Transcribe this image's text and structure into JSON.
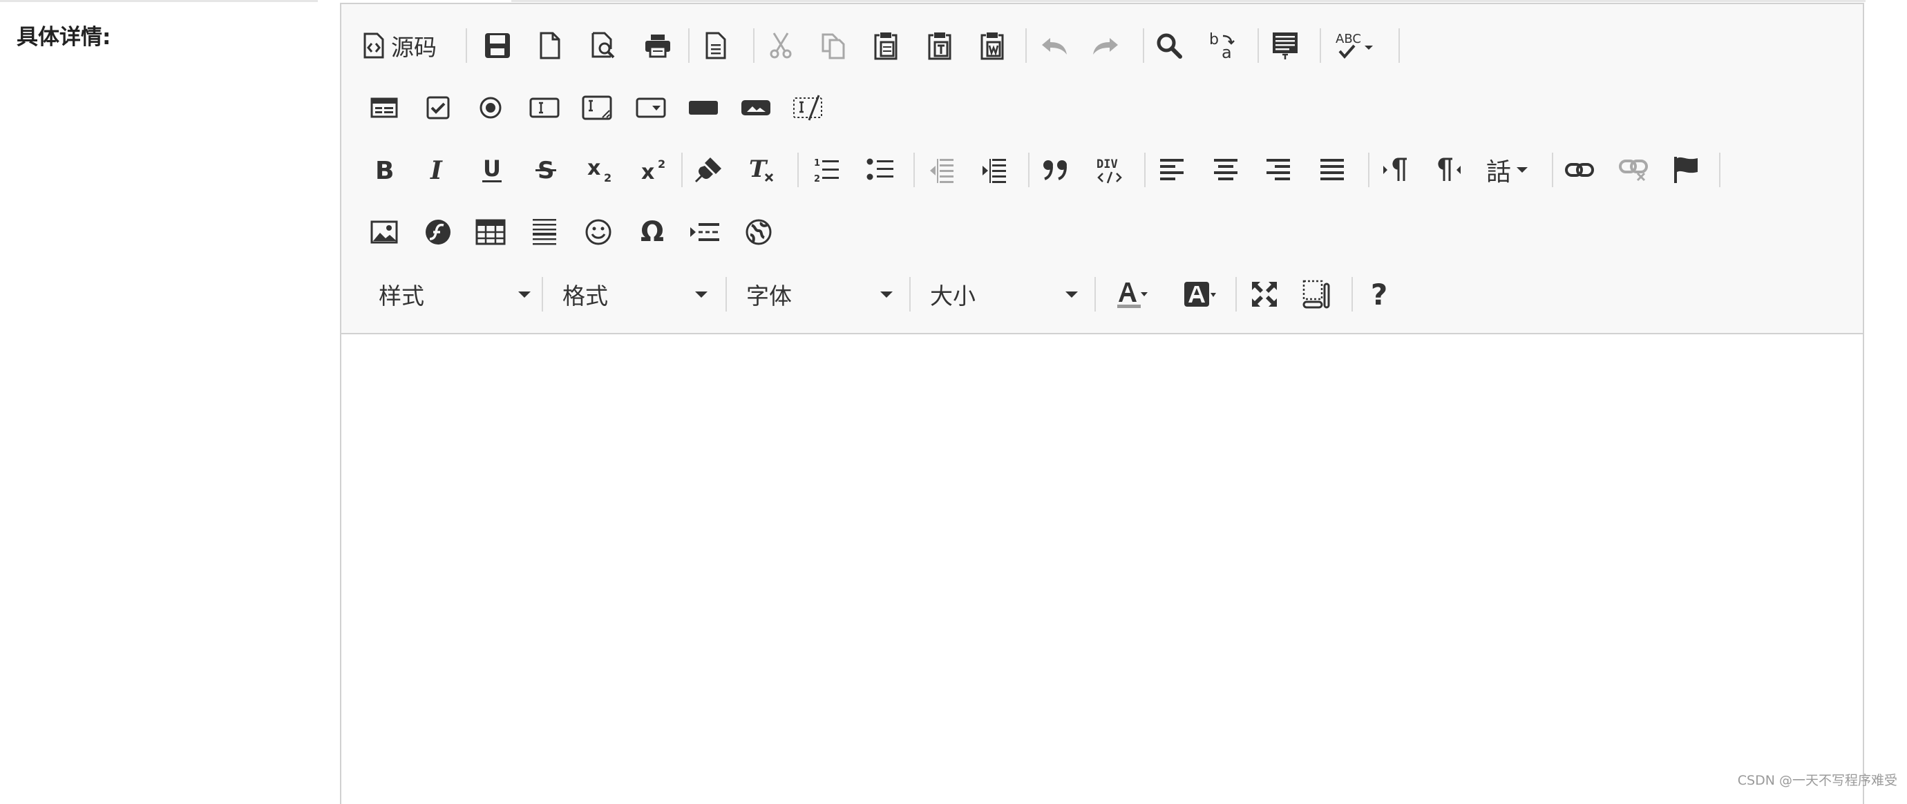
{
  "form": {
    "field_label": "具体详情:"
  },
  "toolbar": {
    "source_label": "源码",
    "combos": {
      "styles": "样式",
      "format": "格式",
      "font": "字体",
      "size": "大小"
    },
    "language_glyph": "話",
    "subscript_char": "x",
    "superscript_char": "x",
    "about_char": "?",
    "div_label": "DIV",
    "spell_label": "ABC",
    "omega_char": "Ω"
  },
  "colors": {
    "icon": "#333333",
    "icon_disabled": "#b4b4b4",
    "toolbar_bg": "#f8f8f8",
    "border": "#d1d1d1"
  },
  "watermark": "CSDN @一天不写程序难受"
}
